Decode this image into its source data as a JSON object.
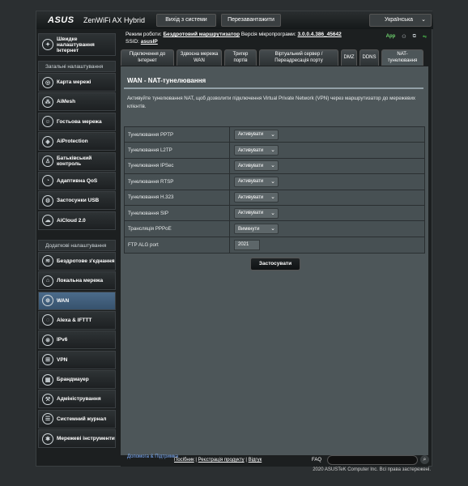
{
  "header": {
    "logo": "ASUS",
    "product": "ZenWiFi AX Hybrid",
    "logout": "Вихід з системи",
    "reboot": "Перезавантажити",
    "language": "Українська"
  },
  "info": {
    "mode_label": "Режим роботи:",
    "mode_value": "Бездротовий маршрутизатор",
    "fw_label": "Версія мікропрограми:",
    "fw_value": "3.0.0.4.386_45642",
    "ssid_label": "SSID:",
    "ssid_value": "asusIP",
    "app_label": "App"
  },
  "sidebar": {
    "quick": "Швидке налаштування Інтернет",
    "general_header": "Загальні налаштування",
    "general": [
      "Карта мережі",
      "AiMesh",
      "Гостьова мережа",
      "AiProtection",
      "Батьківський контроль",
      "Адаптивна QoS",
      "Застосунки USB",
      "AiCloud 2.0"
    ],
    "advanced_header": "Додаткові налаштування",
    "advanced": [
      "Бездротове з'єднання",
      "Локальна мережа",
      "WAN",
      "Alexa & IFTTT",
      "IPv6",
      "VPN",
      "Брандмауер",
      "Адміністрування",
      "Системний журнал",
      "Мережеві інструменти"
    ]
  },
  "tabs": [
    "Підключення до Інтернет",
    "Здвоєна мережа WAN",
    "Тригер портів",
    "Віртуальний сервер / Переадресація порту",
    "DMZ",
    "DDNS",
    "NAT-тунелювання"
  ],
  "page": {
    "title_prefix": "WAN",
    "title_sep": " - ",
    "title_name": "NAT-тунелювання",
    "description": "Активуйте тунелювання NAT, щоб дозволити підключення Virtual Private Network (VPN) через маршрутизатор до мережевих клієнтів.",
    "rows": [
      {
        "label": "Тунелювання PPTP",
        "value": "Активувати"
      },
      {
        "label": "Тунелювання L2TP",
        "value": "Активувати"
      },
      {
        "label": "Тунелювання IPSec",
        "value": "Активувати"
      },
      {
        "label": "Тунелювання RTSP",
        "value": "Активувати"
      },
      {
        "label": "Тунелювання H.323",
        "value": "Активувати"
      },
      {
        "label": "Тунелювання SIP",
        "value": "Активувати"
      },
      {
        "label": "Трансляція PPPoE",
        "value": "Вимкнути"
      }
    ],
    "ftp_label": "FTP ALG port",
    "ftp_value": "2021",
    "apply": "Застосувати"
  },
  "footer": {
    "help": "Допомога & Підтримка",
    "manual": "Посібник",
    "register": "Реєстрація продукту",
    "feedback": "Відгук",
    "faq": "FAQ",
    "copyright": "2020 ASUSTeK Computer Inc. Всі права застережені."
  },
  "colors": {
    "panel": "#4d5659",
    "selected_sidebar": "#4b6b8a",
    "link_blue": "#7fb0ff"
  }
}
